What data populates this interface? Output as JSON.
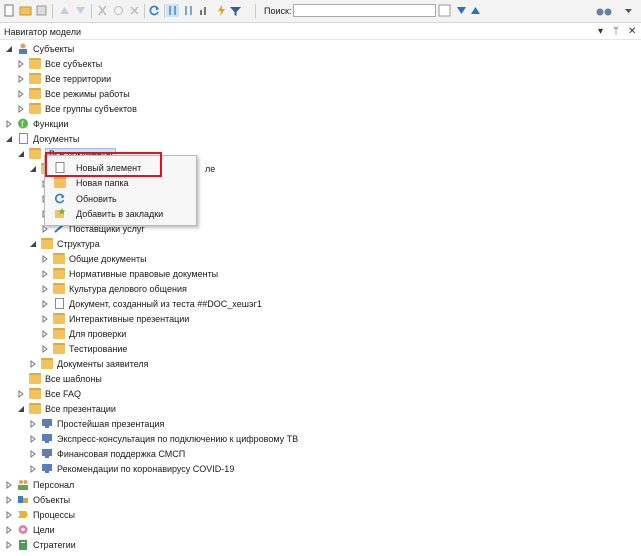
{
  "toolbar": {
    "search_label": "Поиск:",
    "search_value": ""
  },
  "panel": {
    "title": "Навигатор модели",
    "pin_glyph": "ᛘ",
    "close_glyph": "✕",
    "dropdown_glyph": "▾"
  },
  "tree": {
    "subjects": "Субъекты",
    "all_subjects": "Все субъекты",
    "all_territories": "Все территории",
    "all_modes": "Все режимы работы",
    "all_groups": "Все группы субъектов",
    "functions": "Функции",
    "documents": "Документы",
    "all_documents": "Все документы",
    "hidden_row_tail": "ле",
    "service_providers": "Поставщики услуг",
    "structure": "Структура",
    "general_docs": "Общие документы",
    "regulatory_docs": "Нормативные правовые документы",
    "business_culture": "Культура делового общения",
    "test_doc": "Документ, созданный из теста ##DOC_xeшэг1",
    "interactive_pres": "Интерактивные презентации",
    "for_check": "Для проверки",
    "testing": "Тестирование",
    "applicant_docs": "Документы заявителя",
    "all_templates": "Все шаблоны",
    "all_faq": "Все FAQ",
    "all_presentations": "Все презентации",
    "simple_pres": "Простейшая презентация",
    "express_consult": "Экспресс-консультация по подключению к цифровому ТВ",
    "financial_support": "Финансовая поддержка СМСП",
    "covid_reco": "Рекомендации по коронавирусу COVID-19",
    "personnel": "Персонал",
    "objects": "Объекты",
    "processes": "Процессы",
    "goals": "Цели",
    "strategies": "Стратегии"
  },
  "context_menu": {
    "new_element": "Новый элемент",
    "new_folder": "Новая папка",
    "refresh": "Обновить",
    "add_bookmarks": "Добавить в закладки"
  },
  "colors": {
    "highlight": "#e0151b",
    "folder": "#f0c35e",
    "selection": "#cfe3f7"
  }
}
